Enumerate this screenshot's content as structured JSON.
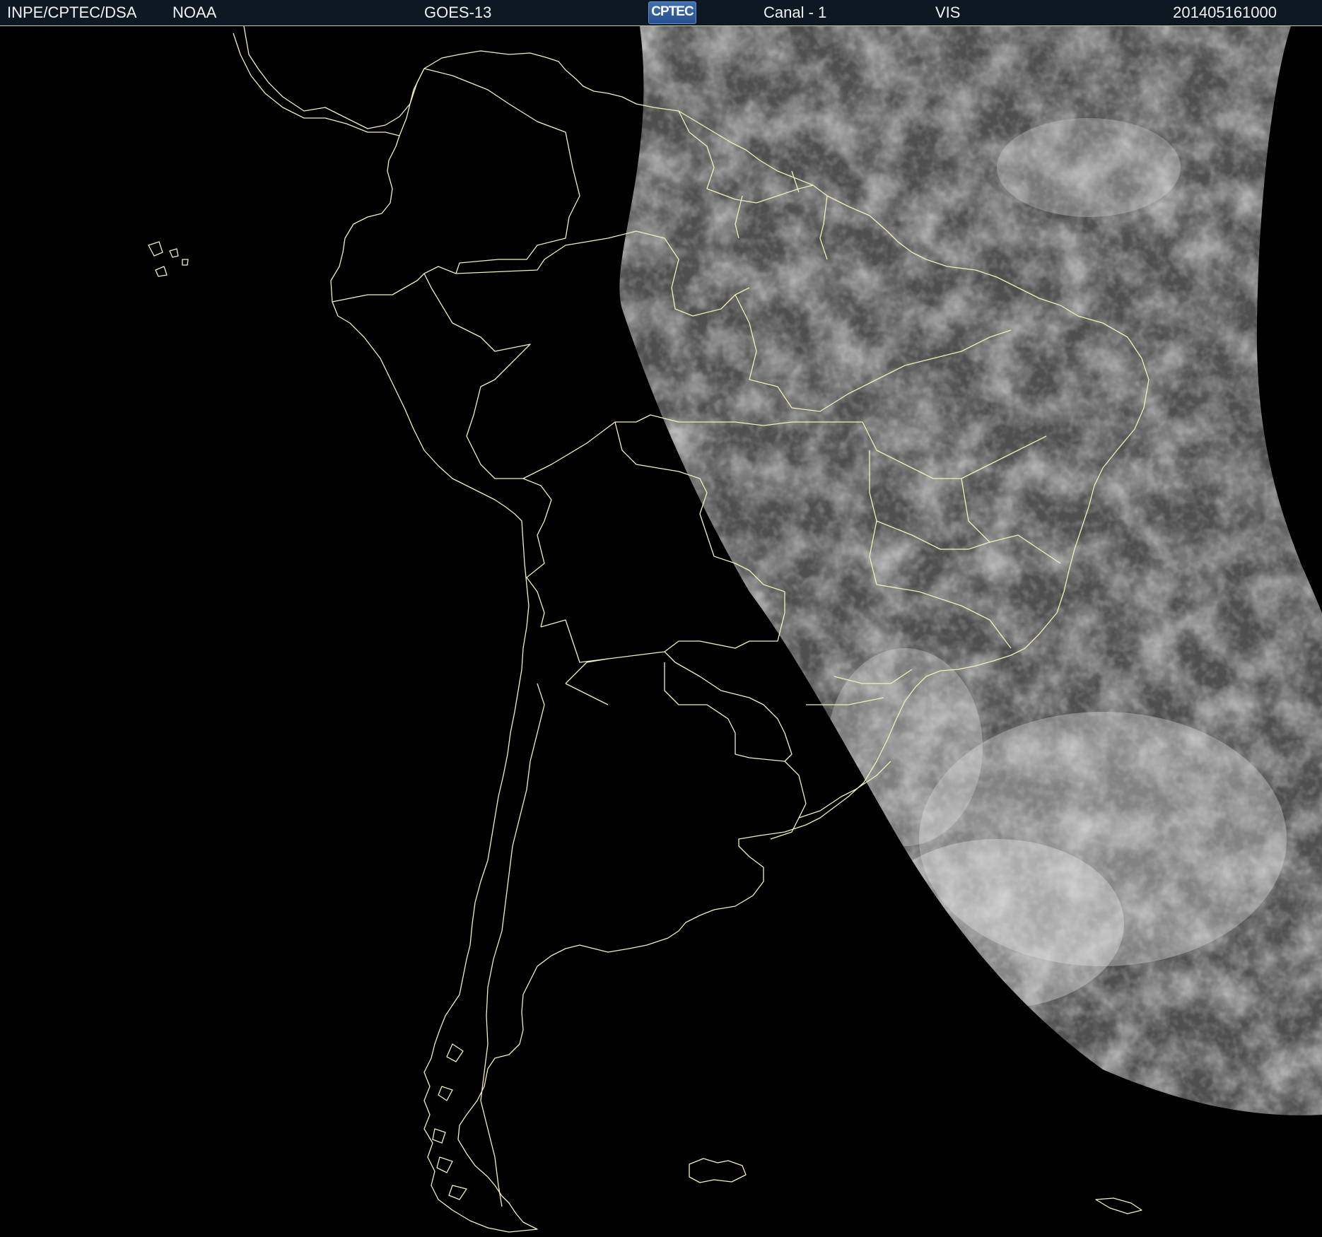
{
  "header": {
    "agency": "INPE/CPTEC/DSA",
    "provider": "NOAA",
    "satellite": "GOES-13",
    "logo_text": "CPTEC",
    "channel": "Canal - 1",
    "band": "VIS",
    "datetime": "201405161000"
  },
  "colors": {
    "header_background": "#0e1823",
    "header_text": "#f2f2f2",
    "boundary_lines": "#f3f0b8",
    "night_side": "#000000",
    "cloud_tone": "#d8d8d8",
    "surface_tone": "#555555"
  },
  "map": {
    "projection": "satellite full-disk crop (geostationary)",
    "region": "South America",
    "illumination": "eastern portion sunlit, western portion in darkness (terminator line)",
    "overlay": "coastlines and political boundaries"
  }
}
